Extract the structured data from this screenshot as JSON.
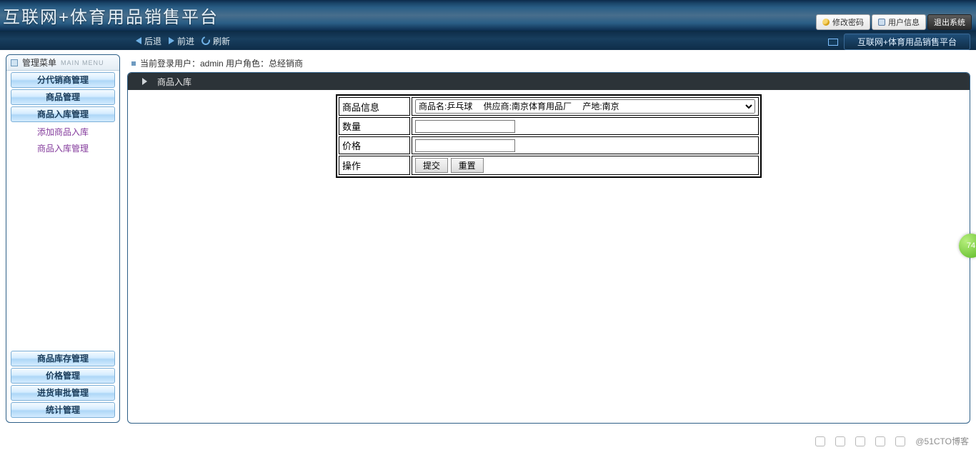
{
  "header": {
    "title": "互联网+体育用品销售平台",
    "change_pwd": "修改密码",
    "user_info": "用户信息",
    "logout": "退出系统"
  },
  "nav": {
    "back": "后退",
    "forward": "前进",
    "refresh": "刷新",
    "app_link": "互联网+体育用品销售平台"
  },
  "sidebar": {
    "menu_title": "管理菜单",
    "menu_sub": "MAIN MENU",
    "items_top": [
      "分代销商管理",
      "商品管理",
      "商品入库管理"
    ],
    "sub_links": [
      "添加商品入库",
      "商品入库管理"
    ],
    "items_bottom": [
      "商品库存管理",
      "价格管理",
      "进货审批管理",
      "统计管理"
    ]
  },
  "status": {
    "text": "当前登录用户：admin 用户角色：总经销商"
  },
  "content": {
    "title": "商品入库",
    "rows": {
      "product_label": "商品信息",
      "product_option": "商品名:乒乓球　 供应商:南京体育用品厂　 产地:南京",
      "qty_label": "数量",
      "price_label": "价格",
      "action_label": "操作",
      "submit": "提交",
      "reset": "重置"
    }
  },
  "footer": {
    "watermark": "@51CTO博客",
    "badge": "74"
  }
}
